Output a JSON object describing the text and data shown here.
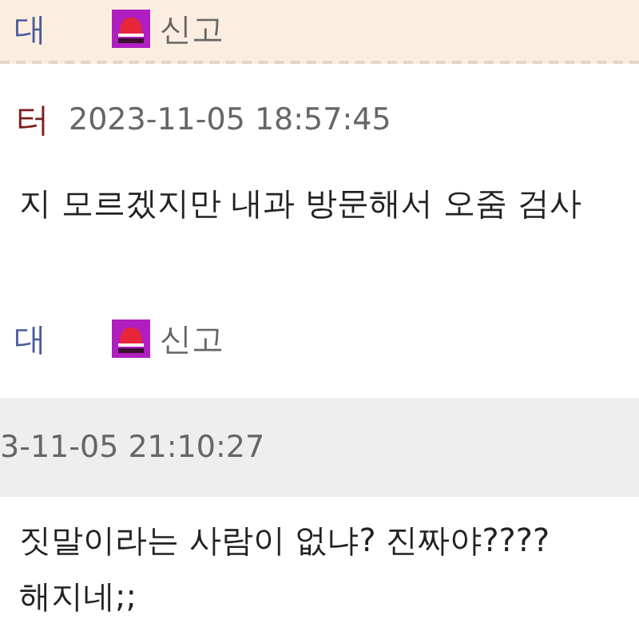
{
  "comments": [
    {
      "header": {
        "author": "터",
        "date": "2023-11-05 18:57:45"
      },
      "body": [
        "지 모르겠지만 내과 방문해서 오줌 검사"
      ],
      "actions": {
        "oppose": "대",
        "report": "신고"
      }
    },
    {
      "header": {
        "date": "3-11-05 21:10:27"
      },
      "body": [
        "짓말이라는 사람이 없냐? 진짜야????",
        "해지네;;"
      ]
    }
  ],
  "top_actions": {
    "oppose": "대",
    "report": "신고"
  }
}
